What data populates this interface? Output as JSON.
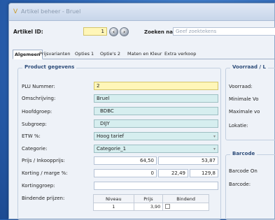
{
  "window": {
    "title": "Artikel beheer - Bruel"
  },
  "header": {
    "artikel_id_label": "Artikel ID:",
    "artikel_id_value": "1",
    "search_label": "Zoeken naar:",
    "search_placeholder": "Geef zoektekens"
  },
  "tabs": [
    "Algemeen",
    "Prijsvarianten",
    "Opties 1",
    "Optie's 2",
    "Maten en Kleur",
    "Extra verkoop"
  ],
  "product": {
    "title": "Product gegevens",
    "plu_label": "PLU Nummer:",
    "plu_value": "2",
    "omschrijving_label": "Omschrijving:",
    "omschrijving_value": "Bruel",
    "hoofdgroep_label": "Hoofdgroep:",
    "hoofdgroep_value": "BDBC",
    "subgroep_label": "Subgroep:",
    "subgroep_value": "DIJY",
    "btw_label": "ETW %:",
    "btw_value": "Hoog tarief",
    "categorie_label": "Categorie:",
    "categorie_value": "Categorie_1",
    "prijs_label": "Prijs / Inkoopprijs:",
    "prijs_value": "64,50",
    "inkoop_value": "53,87",
    "korting_label": "Korting / marge %:",
    "korting_value": "0",
    "marge1_value": "22,49",
    "marge2_value": "129,8",
    "kortinggroep_label": "Kortinggroep:",
    "bindende_label": "Bindende prijzen:",
    "bindende_headers": [
      "Niveau",
      "Prijs",
      "Bindend"
    ],
    "bindende_rows": [
      [
        "1",
        "3,90",
        ""
      ]
    ]
  },
  "voorraad": {
    "title": "Voorraad / L",
    "voorraad_label": "Voorraad:",
    "min_label": "Minimale Vo",
    "max_label": "Maximale vo",
    "lokatie_label": "Lokatie:"
  },
  "barcode": {
    "title": "Barcode",
    "barcode_on_label": "Barcode On",
    "barcode_label": "Barcode:"
  }
}
